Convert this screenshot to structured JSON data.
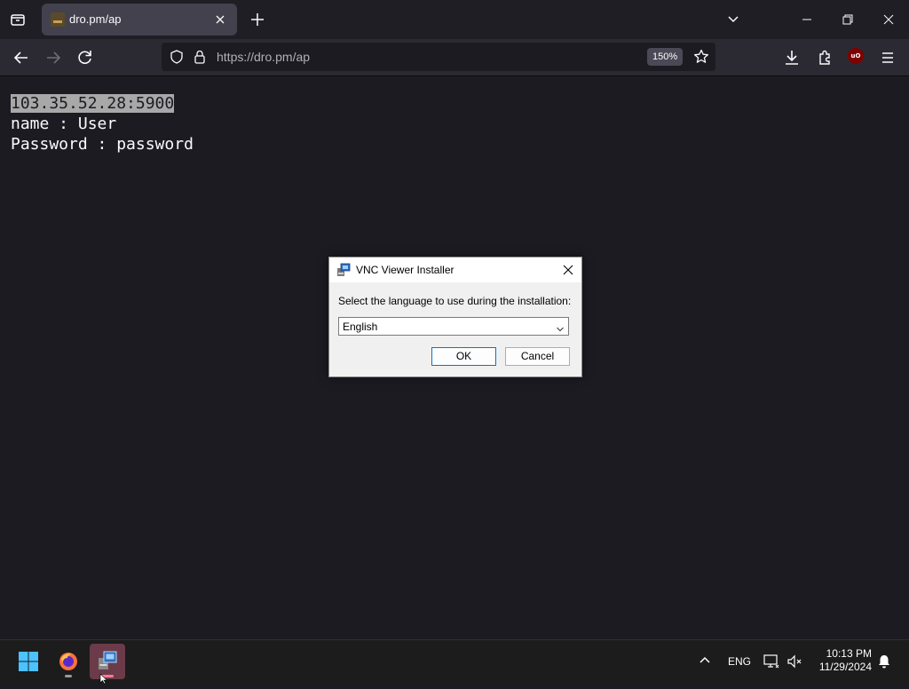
{
  "browser": {
    "tab_title": "dro.pm/ap",
    "url": "https://dro.pm/ap",
    "zoom": "150%"
  },
  "page": {
    "line1": "103.35.52.28:5900",
    "line2": "name : User",
    "line3": "Password : password"
  },
  "dialog": {
    "title": "VNC Viewer Installer",
    "prompt": "Select the language to use during the installation:",
    "selected_language": "English",
    "ok_label": "OK",
    "cancel_label": "Cancel"
  },
  "taskbar": {
    "language": "ENG",
    "time": "10:13 PM",
    "date": "11/29/2024"
  },
  "colors": {
    "page_bg": "#1c1b22",
    "toolbar_bg": "#2b2a33",
    "tab_active_bg": "#42414d",
    "dialog_bg": "#f0f0f0",
    "taskbar_bg": "#1c1c1c",
    "accent": "#0078d4"
  },
  "icons": [
    "tab-list-icon",
    "close-icon",
    "plus-icon",
    "chevron-down-icon",
    "minimize-icon",
    "restore-icon",
    "back-arrow-icon",
    "forward-arrow-icon",
    "reload-icon",
    "shield-icon",
    "lock-icon",
    "star-icon",
    "download-icon",
    "extensions-icon",
    "ublock-icon",
    "hamburger-menu-icon",
    "windows-start-icon",
    "firefox-icon",
    "installer-icon",
    "chevron-up-icon",
    "network-icon",
    "volume-mute-icon",
    "bell-icon"
  ]
}
